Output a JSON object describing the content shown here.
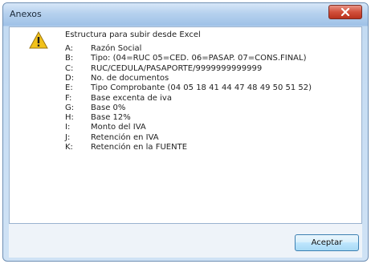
{
  "window": {
    "title": "Anexos"
  },
  "dialog": {
    "heading": "Estructura para subir desde Excel",
    "fields": [
      {
        "key": "A:",
        "desc": "Razón Social"
      },
      {
        "key": "B:",
        "desc": "Tipo: (04=RUC 05=CED. 06=PASAP. 07=CONS.FINAL)"
      },
      {
        "key": "C:",
        "desc": "RUC/CEDULA/PASAPORTE/9999999999999"
      },
      {
        "key": "D:",
        "desc": "No. de documentos"
      },
      {
        "key": "E:",
        "desc": "Tipo Comprobante (04 05 18 41 44 47 48 49 50 51 52)"
      },
      {
        "key": "F:",
        "desc": "Base excenta de iva"
      },
      {
        "key": "G:",
        "desc": "Base 0%"
      },
      {
        "key": "H:",
        "desc": "Base 12%"
      },
      {
        "key": "I:",
        "desc": "Monto del IVA"
      },
      {
        "key": "J:",
        "desc": "Retención en IVA"
      },
      {
        "key": "K:",
        "desc": "Retención en la FUENTE"
      }
    ]
  },
  "buttons": {
    "accept": "Aceptar"
  },
  "icons": {
    "warning": "warning-icon",
    "close": "close-icon"
  },
  "colors": {
    "warning_fill": "#f2c21a",
    "close_button": "#d2503b"
  }
}
